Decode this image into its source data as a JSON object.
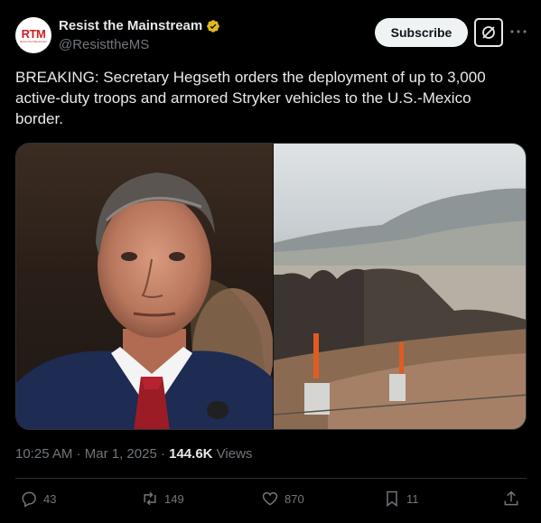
{
  "account": {
    "avatar_text": "RTM",
    "avatar_subtext": "Resist the Mainstream",
    "display_name": "Resist the Mainstream",
    "handle": "@ResisttheMS",
    "verified_color": "#e2b719"
  },
  "header": {
    "subscribe_label": "Subscribe",
    "more_icon": "ellipsis-icon",
    "grok_icon": "grok-icon"
  },
  "tweet": {
    "text": "BREAKING: Secretary Hegseth orders the deployment of up to 3,000 active-duty troops and armored Stryker vehicles to the U.S.-Mexico border."
  },
  "meta": {
    "time": "10:25 AM",
    "separator": " · ",
    "date": "Mar 1, 2025",
    "views_count": "144.6K",
    "views_label": " Views"
  },
  "actions": {
    "replies": "43",
    "reposts": "149",
    "likes": "870",
    "bookmarks": "11"
  },
  "colors": {
    "background": "#000000",
    "text": "#e7e9ea",
    "muted": "#71767b",
    "border": "#2f3336",
    "brand_red": "#d01f27"
  }
}
